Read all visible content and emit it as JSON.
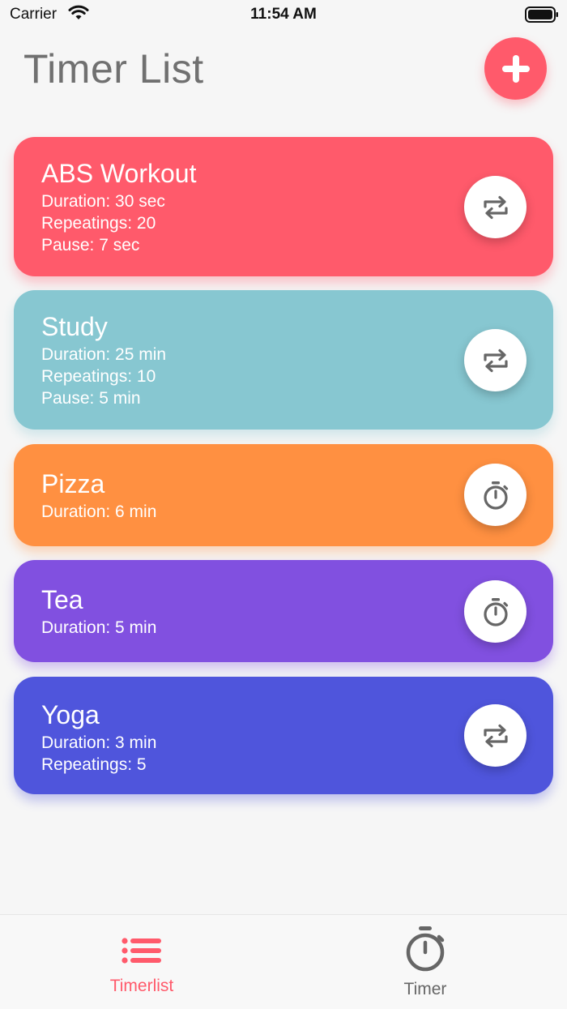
{
  "status_bar": {
    "carrier": "Carrier",
    "time": "11:54 AM"
  },
  "header": {
    "title": "Timer List",
    "add_icon": "plus-icon",
    "accent_color": "#ff5a6b"
  },
  "timers": [
    {
      "title": "ABS Workout",
      "color": "#ff5a6b",
      "lines": [
        "Duration: 30 sec",
        "Repeatings: 20",
        "Pause: 7 sec"
      ],
      "icon": "repeat-icon"
    },
    {
      "title": "Study",
      "color": "#87c7d1",
      "lines": [
        "Duration: 25 min",
        "Repeatings: 10",
        "Pause: 5 min"
      ],
      "icon": "repeat-icon"
    },
    {
      "title": "Pizza",
      "color": "#ff9041",
      "lines": [
        "Duration: 6 min"
      ],
      "icon": "stopwatch-icon"
    },
    {
      "title": "Tea",
      "color": "#8150e0",
      "lines": [
        "Duration: 5 min"
      ],
      "icon": "stopwatch-icon"
    },
    {
      "title": "Yoga",
      "color": "#4f55dc",
      "lines": [
        "Duration: 3 min",
        "Repeatings: 5"
      ],
      "icon": "repeat-icon"
    }
  ],
  "tab_bar": {
    "tabs": [
      {
        "label": "Timerlist",
        "icon": "list-icon",
        "active": true,
        "color": "#ff5a6b"
      },
      {
        "label": "Timer",
        "icon": "stopwatch-icon",
        "active": false,
        "color": "#666666"
      }
    ]
  }
}
